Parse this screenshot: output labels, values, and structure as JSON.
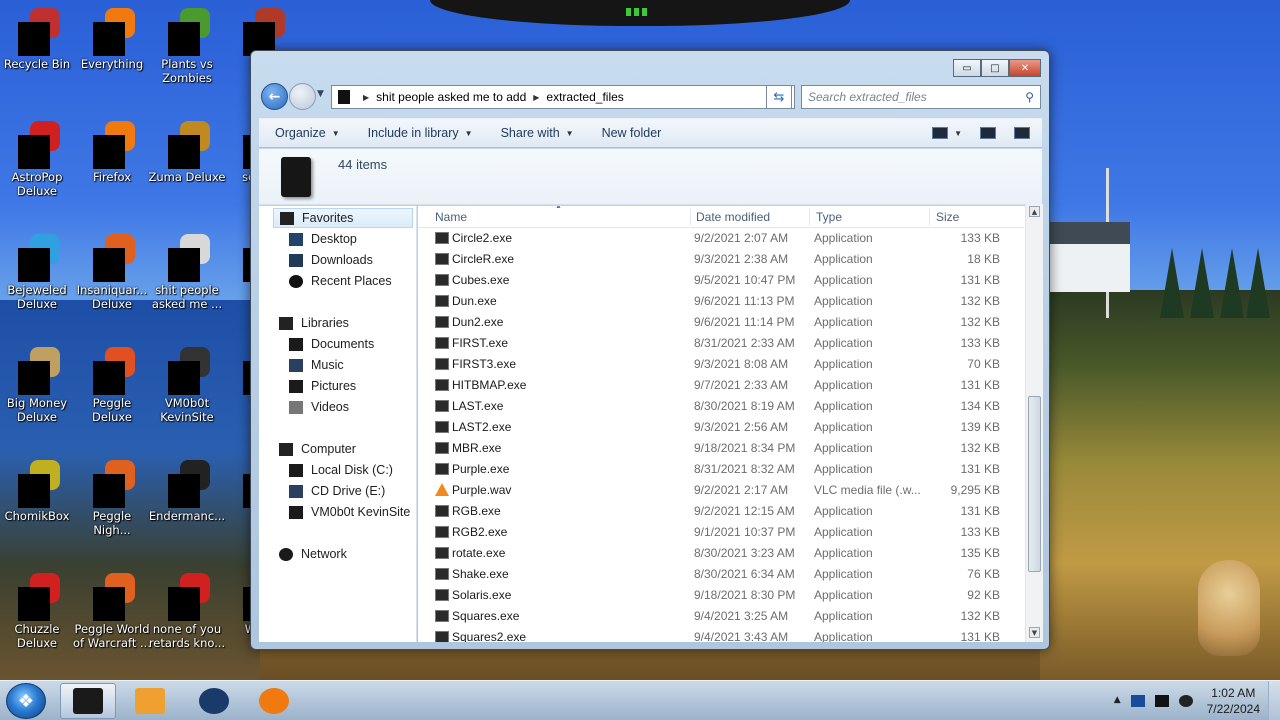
{
  "desktop": {
    "icons": [
      {
        "label": "Recycle Bin",
        "color": "#c03030"
      },
      {
        "label": "Everything",
        "color": "#f07a10"
      },
      {
        "label": "Plants vs Zombies",
        "color": "#4a9a30"
      },
      {
        "label": "Sola",
        "color": "#b03a2a"
      },
      {
        "label": "AstroPop Deluxe",
        "color": "#d02020"
      },
      {
        "label": "Firefox",
        "color": "#f07a10"
      },
      {
        "label": "Zuma Deluxe",
        "color": "#c08a20"
      },
      {
        "label": "som ra",
        "color": "#e0c020"
      },
      {
        "label": "Bejeweled Deluxe",
        "color": "#30a0e0"
      },
      {
        "label": "Insaniquar... Deluxe",
        "color": "#e06020"
      },
      {
        "label": "shit people asked me ...",
        "color": "#d8d8d8"
      },
      {
        "label": "tha",
        "color": "#999"
      },
      {
        "label": "Big Money Deluxe",
        "color": "#c0a060"
      },
      {
        "label": "Peggle Deluxe",
        "color": "#e05020"
      },
      {
        "label": "VM0b0t KevinSite",
        "color": "#333"
      },
      {
        "label": "Visu",
        "color": "#6040c0"
      },
      {
        "label": "ChomikBox",
        "color": "#c0b020"
      },
      {
        "label": "Peggle Nigh...",
        "color": "#e06020"
      },
      {
        "label": "Endermanc...",
        "color": "#222"
      },
      {
        "label": "Ke",
        "color": "#444"
      },
      {
        "label": "Chuzzle Deluxe",
        "color": "#d02020"
      },
      {
        "label": "Peggle World of Warcraft ...",
        "color": "#e06020"
      },
      {
        "label": "none of you retards kno...",
        "color": "#d02020"
      },
      {
        "label": "Wi Liv",
        "color": "#444"
      }
    ]
  },
  "window": {
    "caption_buttons": {
      "minimize": "▭",
      "maximize": "□",
      "close": "✕"
    },
    "address": {
      "crumbs": [
        "shit people asked me to add",
        "extracted_files"
      ]
    },
    "search": {
      "placeholder": "Search extracted_files"
    },
    "toolbar": {
      "organize": "Organize",
      "include_in_library": "Include in library",
      "share_with": "Share with",
      "new_folder": "New folder"
    },
    "info": {
      "count": "44 items"
    },
    "nav": {
      "favorites": "Favorites",
      "desktop": "Desktop",
      "downloads": "Downloads",
      "recent": "Recent Places",
      "libraries": "Libraries",
      "documents": "Documents",
      "music": "Music",
      "pictures": "Pictures",
      "videos": "Videos",
      "computer": "Computer",
      "local_disk": "Local Disk (C:)",
      "cd_drive": "CD Drive (E:)",
      "vm": "VM0b0t KevinSite",
      "network": "Network"
    },
    "columns": {
      "name": "Name",
      "date": "Date modified",
      "type": "Type",
      "size": "Size"
    },
    "files": [
      {
        "name": "Circle2.exe",
        "date": "9/2/2021 2:07 AM",
        "type": "Application",
        "size": "133 KB"
      },
      {
        "name": "CircleR.exe",
        "date": "9/3/2021 2:38 AM",
        "type": "Application",
        "size": "18 KB"
      },
      {
        "name": "Cubes.exe",
        "date": "9/5/2021 10:47 PM",
        "type": "Application",
        "size": "131 KB"
      },
      {
        "name": "Dun.exe",
        "date": "9/6/2021 11:13 PM",
        "type": "Application",
        "size": "132 KB"
      },
      {
        "name": "Dun2.exe",
        "date": "9/6/2021 11:14 PM",
        "type": "Application",
        "size": "132 KB"
      },
      {
        "name": "FIRST.exe",
        "date": "8/31/2021 2:33 AM",
        "type": "Application",
        "size": "133 KB"
      },
      {
        "name": "FIRST3.exe",
        "date": "9/3/2021 8:08 AM",
        "type": "Application",
        "size": "70 KB"
      },
      {
        "name": "HITBMAP.exe",
        "date": "9/7/2021 2:33 AM",
        "type": "Application",
        "size": "131 KB"
      },
      {
        "name": "LAST.exe",
        "date": "8/30/2021 8:19 AM",
        "type": "Application",
        "size": "134 KB"
      },
      {
        "name": "LAST2.exe",
        "date": "9/3/2021 2:56 AM",
        "type": "Application",
        "size": "139 KB"
      },
      {
        "name": "MBR.exe",
        "date": "9/18/2021 8:34 PM",
        "type": "Application",
        "size": "132 KB"
      },
      {
        "name": "Purple.exe",
        "date": "8/31/2021 8:32 AM",
        "type": "Application",
        "size": "131 KB"
      },
      {
        "name": "Purple.wav",
        "date": "9/2/2021 2:17 AM",
        "type": "VLC media file (.w...",
        "size": "9,295 KB",
        "icon": "vlc"
      },
      {
        "name": "RGB.exe",
        "date": "9/2/2021 12:15 AM",
        "type": "Application",
        "size": "131 KB"
      },
      {
        "name": "RGB2.exe",
        "date": "9/1/2021 10:37 PM",
        "type": "Application",
        "size": "133 KB"
      },
      {
        "name": "rotate.exe",
        "date": "8/30/2021 3:23 AM",
        "type": "Application",
        "size": "135 KB"
      },
      {
        "name": "Shake.exe",
        "date": "8/30/2021 6:34 AM",
        "type": "Application",
        "size": "76 KB"
      },
      {
        "name": "Solaris.exe",
        "date": "9/18/2021 8:30 PM",
        "type": "Application",
        "size": "92 KB"
      },
      {
        "name": "Squares.exe",
        "date": "9/4/2021 3:25 AM",
        "type": "Application",
        "size": "132 KB"
      },
      {
        "name": "Squares2.exe",
        "date": "9/4/2021 3:43 AM",
        "type": "Application",
        "size": "131 KB"
      }
    ]
  },
  "taskbar": {
    "clock": {
      "time": "1:02 AM",
      "date": "7/22/2024"
    },
    "apps": [
      {
        "name": "explorer",
        "color": "#1a1a1a",
        "active": true
      },
      {
        "name": "media-player",
        "color": "#f0a030",
        "active": false
      },
      {
        "name": "globe",
        "color": "#1a3a6a",
        "active": false
      },
      {
        "name": "firefox",
        "color": "#f07a10",
        "active": false
      }
    ]
  }
}
